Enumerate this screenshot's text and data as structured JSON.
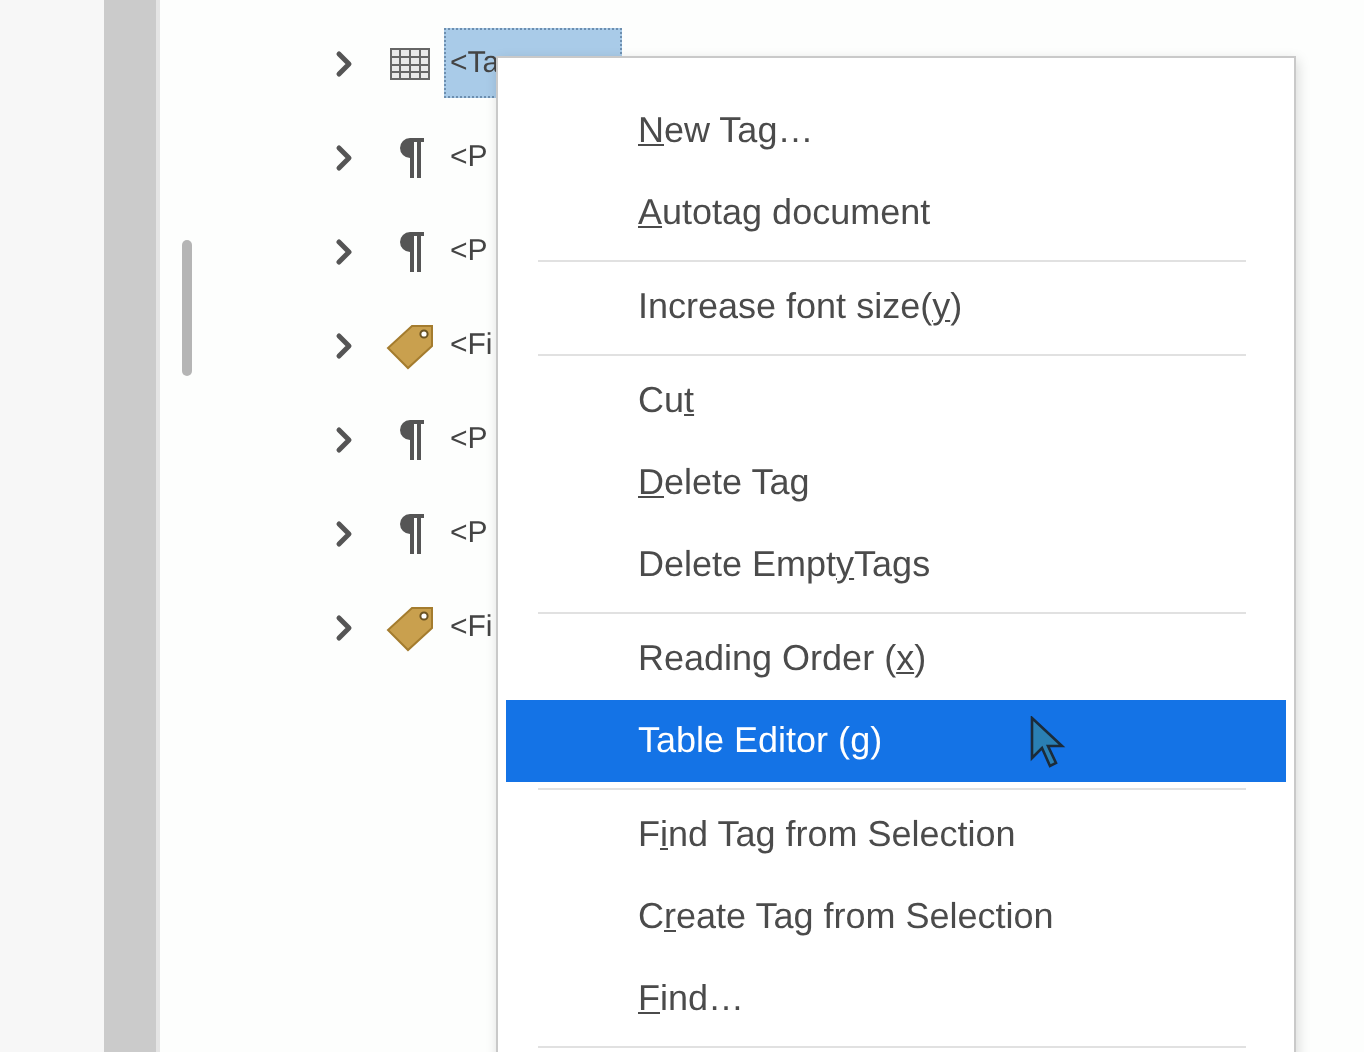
{
  "tree": [
    {
      "kind": "table",
      "label": "<Ta",
      "selected": true
    },
    {
      "kind": "paragraph",
      "label": "<P",
      "selected": false
    },
    {
      "kind": "paragraph",
      "label": "<P",
      "selected": false
    },
    {
      "kind": "figure",
      "label": "<Fi",
      "selected": false
    },
    {
      "kind": "paragraph",
      "label": "<P",
      "selected": false
    },
    {
      "kind": "paragraph",
      "label": "<P",
      "selected": false
    },
    {
      "kind": "figure",
      "label": "<Fi",
      "selected": false
    }
  ],
  "context_menu": [
    {
      "kind": "item",
      "key": "N",
      "post": "ew Tag…",
      "selected": false
    },
    {
      "kind": "item",
      "key": "A",
      "post": "utotag document",
      "selected": false
    },
    {
      "kind": "separator"
    },
    {
      "kind": "item",
      "pre": "Increase font size(",
      "key": "y",
      "post": ")",
      "selected": false
    },
    {
      "kind": "separator"
    },
    {
      "kind": "item",
      "pre": "Cu",
      "key": "t",
      "selected": false
    },
    {
      "kind": "item",
      "key": "D",
      "post": "elete Tag",
      "selected": false
    },
    {
      "kind": "item",
      "pre": "Delete Empt",
      "key": "y",
      "post": " Tags",
      "selected": false
    },
    {
      "kind": "separator"
    },
    {
      "kind": "item",
      "pre": "Reading Order (",
      "key": "x",
      "post": ")",
      "selected": false
    },
    {
      "kind": "item",
      "pre": "Table Editor (",
      "key": "g",
      "post": ")",
      "selected": true
    },
    {
      "kind": "separator"
    },
    {
      "kind": "item",
      "pre": "F",
      "key": "i",
      "post": "nd Tag from Selection",
      "selected": false
    },
    {
      "kind": "item",
      "pre": "C",
      "key": "r",
      "post": "eate Tag from Selection",
      "selected": false
    },
    {
      "kind": "item",
      "key": "F",
      "post": "ind…",
      "selected": false
    },
    {
      "kind": "separator"
    }
  ]
}
